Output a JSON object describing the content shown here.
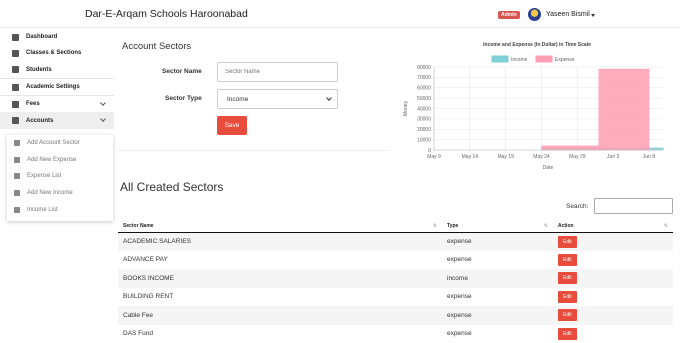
{
  "header": {
    "brand": "Dar-E-Arqam Schools Haroonabad",
    "badge": "Admin",
    "username": "Yaseen Bismil"
  },
  "sidebar": {
    "items": [
      {
        "label": "Dashboard",
        "icon": "dashboard-icon"
      },
      {
        "label": "Classes & Sections",
        "icon": "book-icon"
      },
      {
        "label": "Students",
        "icon": "id-card-icon"
      },
      {
        "label": "Academic Settings",
        "icon": "gear-icon"
      },
      {
        "label": "Fees",
        "icon": "dollar-icon"
      },
      {
        "label": "Accounts",
        "icon": "ledger-icon"
      }
    ],
    "submenu": [
      {
        "label": "Add Account Sector",
        "icon": "list-icon"
      },
      {
        "label": "Add New Expense",
        "icon": "file-icon"
      },
      {
        "label": "Expense List",
        "icon": "list-icon"
      },
      {
        "label": "Add New Income",
        "icon": "file-icon"
      },
      {
        "label": "Income List",
        "icon": "list-icon"
      }
    ]
  },
  "form": {
    "title": "Account Sectors",
    "sector_name_label": "Sector Name",
    "sector_name_placeholder": "Sector Name",
    "sector_type_label": "Sector Type",
    "sector_type_value": "Income",
    "save_label": "Save"
  },
  "chart_data": {
    "type": "bar",
    "title": "Income and Expense (In Dollar) in Time Scale",
    "xlabel": "Date",
    "ylabel": "Money",
    "ylim": [
      0,
      80000
    ],
    "yticks": [
      "80000",
      "70000",
      "60000",
      "50000",
      "40000",
      "30000",
      "20000",
      "10000",
      "0"
    ],
    "xticks": [
      "May 9",
      "May 14",
      "May 19",
      "May 24",
      "May 29",
      "Jun 3",
      "Jun 8"
    ],
    "legend_position": "top",
    "grid": true,
    "series": [
      {
        "name": "Income",
        "color": "#7fcfd6",
        "bars": [
          {
            "start": "May 24",
            "end": "Jun 10",
            "value": 2000
          }
        ]
      },
      {
        "name": "Expense",
        "color": "#ff9db3",
        "bars": [
          {
            "start": "May 24",
            "end": "Jun 1",
            "value": 4000
          },
          {
            "start": "Jun 1",
            "end": "Jun 8",
            "value": 78000
          }
        ]
      }
    ]
  },
  "table": {
    "section_title": "All Created Sectors",
    "search_label": "Search:",
    "columns": [
      "Sector Name",
      "Type",
      "Action"
    ],
    "edit_label": "Edit",
    "rows": [
      {
        "name": "ACADEMIC SALARIES",
        "type": "expense"
      },
      {
        "name": "ADVANCE PAY",
        "type": "expense"
      },
      {
        "name": "BOOKS INCOME",
        "type": "income"
      },
      {
        "name": "BUILDING RENT",
        "type": "expense"
      },
      {
        "name": "Cable Fee",
        "type": "expense"
      },
      {
        "name": "DAS Fund",
        "type": "expense"
      }
    ]
  }
}
